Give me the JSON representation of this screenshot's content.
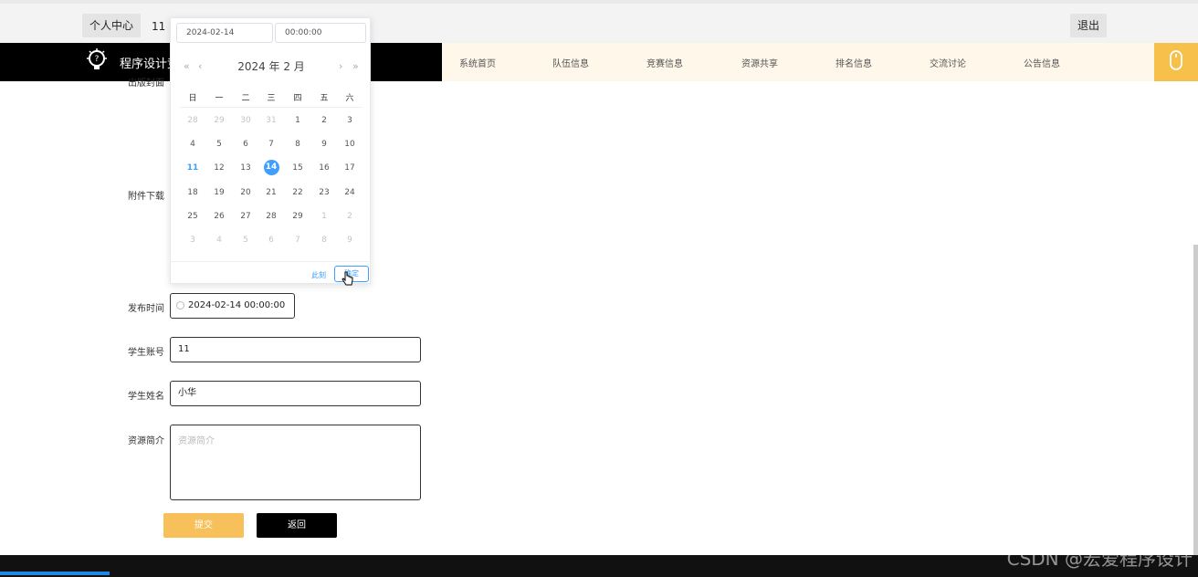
{
  "topbar": {
    "personal_center": "个人中心",
    "user": "11",
    "logout": "退出"
  },
  "navbar": {
    "logo_text": "程序设计竞",
    "items": [
      "系统首页",
      "队伍信息",
      "竞赛信息",
      "资源共享",
      "排名信息",
      "交流讨论",
      "公告信息"
    ]
  },
  "form": {
    "label_cover_partial": "出版封面",
    "label_attachment": "附件下载",
    "label_publish_time": "发布时间",
    "publish_time_value": "2024-02-14 00:00:00",
    "label_student_account": "学生账号",
    "student_account_value": "11",
    "label_student_name": "学生姓名",
    "student_name_value": "小华",
    "label_intro": "资源简介",
    "intro_placeholder": "资源简介",
    "submit": "提交",
    "back": "返回"
  },
  "picker": {
    "date_value": "2024-02-14",
    "time_value": "00:00:00",
    "prev_year": "«",
    "prev_month": "‹",
    "next_month": "›",
    "next_year": "»",
    "title": "2024 年  2 月",
    "weekdays": [
      "日",
      "一",
      "二",
      "三",
      "四",
      "五",
      "六"
    ],
    "weeks": [
      [
        "28",
        "29",
        "30",
        "31",
        "1",
        "2",
        "3"
      ],
      [
        "4",
        "5",
        "6",
        "7",
        "8",
        "9",
        "10"
      ],
      [
        "11",
        "12",
        "13",
        "14",
        "15",
        "16",
        "17"
      ],
      [
        "18",
        "19",
        "20",
        "21",
        "22",
        "23",
        "24"
      ],
      [
        "25",
        "26",
        "27",
        "28",
        "29",
        "1",
        "2"
      ],
      [
        "3",
        "4",
        "5",
        "6",
        "7",
        "8",
        "9"
      ]
    ],
    "now": "此刻",
    "ok": "确定"
  },
  "watermark": "CSDN @宏爱程序设计",
  "colors": {
    "accent": "#409eff",
    "brand": "#f7c04a",
    "nav_bg": "#fff7ea"
  }
}
